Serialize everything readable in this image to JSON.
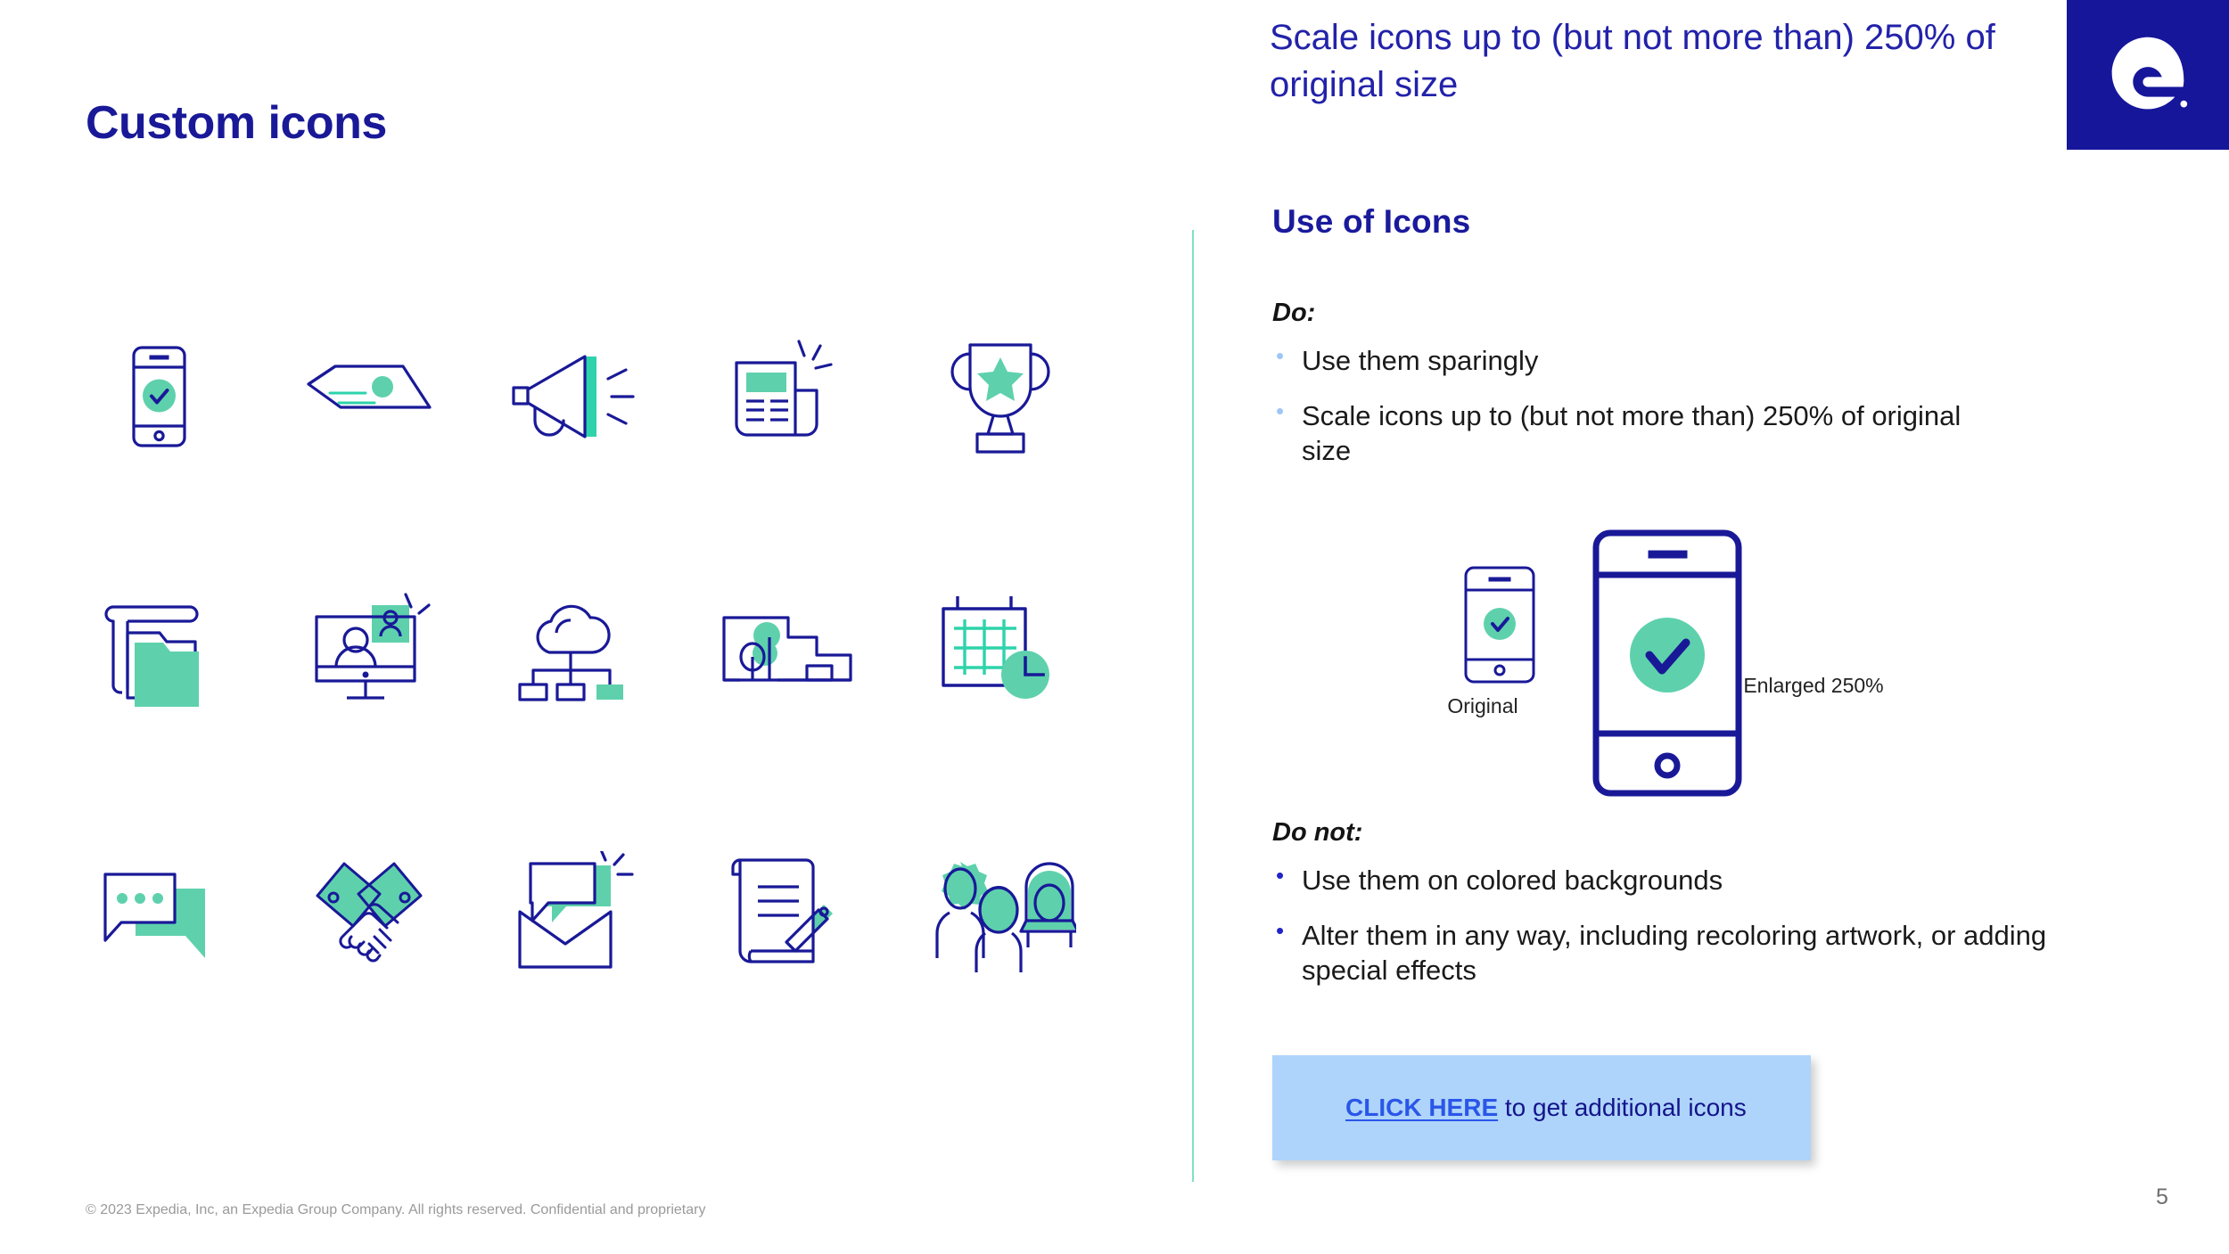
{
  "brand": {
    "navy": "#191998",
    "green": "#5ED1AC",
    "teal": "#2ED3AB",
    "light_blue": "#AED4FB",
    "link_blue": "#2A56E8",
    "logo_letter": "e"
  },
  "left": {
    "title": "Custom icons",
    "icons": [
      {
        "name": "mobile-check-icon",
        "label": "Mobile check"
      },
      {
        "name": "paper-plane-icon",
        "label": "Paper plane"
      },
      {
        "name": "megaphone-icon",
        "label": "Megaphone"
      },
      {
        "name": "newspaper-icon",
        "label": "Newspaper"
      },
      {
        "name": "trophy-icon",
        "label": "Trophy"
      },
      {
        "name": "folder-files-icon",
        "label": "Folder and files"
      },
      {
        "name": "video-call-icon",
        "label": "Video call"
      },
      {
        "name": "cloud-network-icon",
        "label": "Cloud network"
      },
      {
        "name": "office-building-icon",
        "label": "Office building"
      },
      {
        "name": "calendar-clock-icon",
        "label": "Calendar with clock"
      },
      {
        "name": "chat-bubbles-icon",
        "label": "Chat bubbles"
      },
      {
        "name": "handshake-icon",
        "label": "Handshake"
      },
      {
        "name": "envelope-message-icon",
        "label": "Envelope with message"
      },
      {
        "name": "contract-signature-icon",
        "label": "Contract with pen"
      },
      {
        "name": "people-group-icon",
        "label": "Group of people"
      }
    ]
  },
  "right": {
    "header": "Scale icons up to (but not more than) 250% of original size",
    "section_title": "Use of Icons",
    "do_label": "Do:",
    "do_items": [
      "Use them sparingly",
      "Scale icons up to (but not more than) 250% of original size"
    ],
    "scale_demo": {
      "original_label": "Original",
      "enlarged_label": "Enlarged 250%"
    },
    "donot_label": "Do not:",
    "donot_items": [
      "Use them on colored backgrounds",
      "Alter them in any way, including recoloring artwork, or adding special effects"
    ],
    "cta": {
      "link_text": "CLICK HERE",
      "rest_text": " to get additional icons"
    }
  },
  "footer": {
    "copyright": "© 2023 Expedia, Inc, an Expedia Group Company. All rights reserved. Confidential and proprietary",
    "page_number": "5"
  }
}
